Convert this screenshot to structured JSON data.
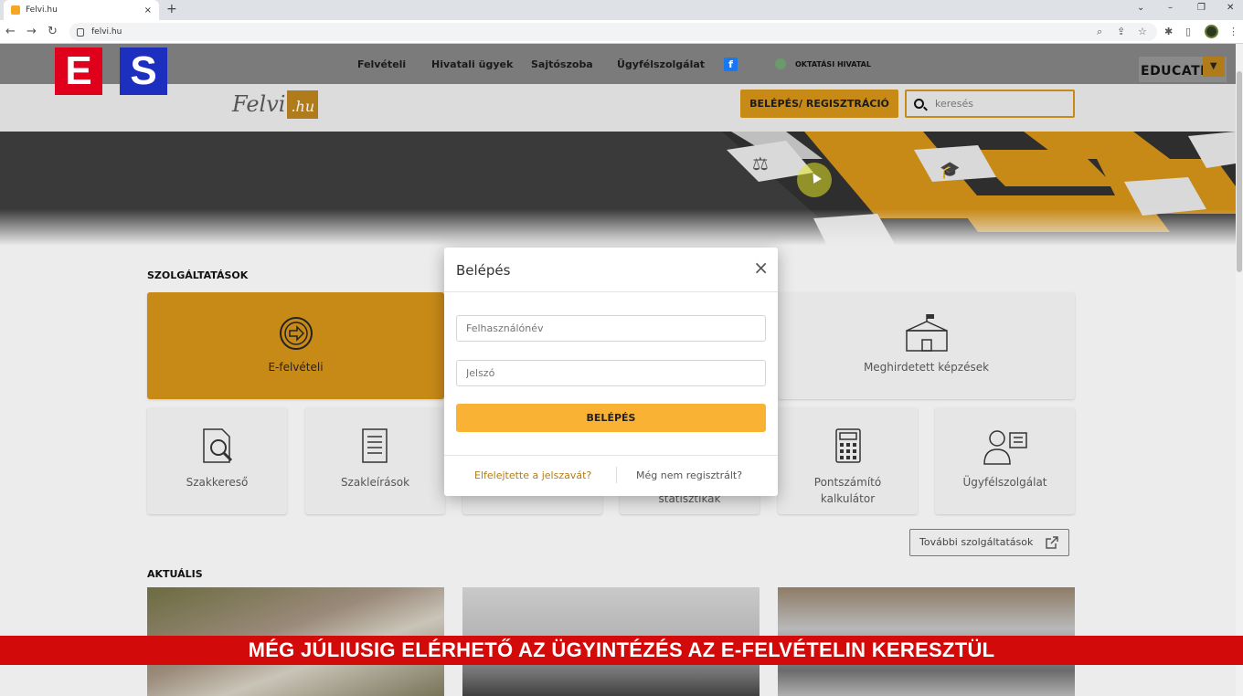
{
  "browser": {
    "tab_title": "Felvi.hu",
    "url": "felvi.hu",
    "new_tab": "+",
    "tab_close": "×",
    "controls": {
      "minimize": "–",
      "restore": "❐",
      "close": "✕",
      "tabs_menu": "⌄"
    },
    "nav": {
      "back": "←",
      "forward": "→",
      "reload": "↻"
    },
    "icons": {
      "zoom": "⌕",
      "share": "⇪",
      "star": "☆",
      "extensions": "✱",
      "sidepanel": "▯",
      "menu": "⋮"
    }
  },
  "channel_logo": {
    "e": "E",
    "s": "S"
  },
  "topnav": {
    "items": [
      "Felvételi",
      "Hivatali ügyek",
      "Sajtószoba",
      "Ügyfélszolgálat"
    ],
    "facebook": "f",
    "oktatasi": "OKTATÁSI HIVATAL",
    "educatio": "EDUCATIO",
    "educatio_dropdown": "▼"
  },
  "header": {
    "logo_text": "Felvi",
    "logo_suffix": ".hu",
    "login_button": "BELÉPÉS/ REGISZTRÁCIÓ",
    "search_placeholder": "keresés"
  },
  "services": {
    "title": "SZOLGÁLTATÁSOK",
    "cards": {
      "efelveteli": "E-felvételi",
      "meghirdetett": "Meghirdetett képzések",
      "szakkereso": "Szakkereső",
      "szakleirasok": "Szakleírások",
      "statisztikak": "statisztikák",
      "pontszamito_1": "Pontszámító",
      "pontszamito_2": "kalkulátor",
      "ugyfelszolgalat": "Ügyfélszolgálat"
    },
    "more_button": "További szolgáltatások"
  },
  "news": {
    "title": "AKTUÁLIS"
  },
  "modal": {
    "title": "Belépés",
    "close": "×",
    "username_placeholder": "Felhasználónév",
    "password_placeholder": "Jelszó",
    "submit": "BELÉPÉS",
    "forgot": "Elfelejtette a jelszavát?",
    "register": "Még nem regisztrált?"
  },
  "banner": {
    "text": "MÉG JÚLIUSIG ELÉRHETŐ AZ ÜGYINTÉZÉS AZ E-FELVÉTELIN KERESZTÜL"
  },
  "colors": {
    "gold": "#c88a17",
    "button_yellow": "#f9b233",
    "banner_red": "#d20a0a"
  }
}
